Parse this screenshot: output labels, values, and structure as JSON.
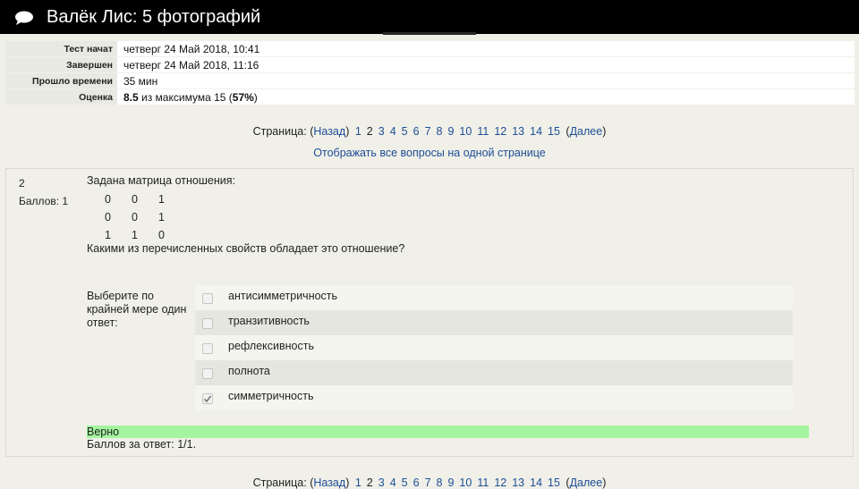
{
  "header": {
    "title": "Валёк Лис: 5 фотографий",
    "icon": "chat-bubble-icon"
  },
  "summary": [
    {
      "label": "Тест начат",
      "value": "четверг 24 Май 2018, 10:41"
    },
    {
      "label": "Завершен",
      "value": "четверг 24 Май 2018, 11:16"
    },
    {
      "label": "Прошло времени",
      "value": "35 мин"
    }
  ],
  "grade": {
    "label": "Оценка",
    "score": "8.5",
    "middle": " из максимума 15 (",
    "percent": "57%",
    "end": ")"
  },
  "pager": {
    "prefix": "Страница: (",
    "prev": "Назад",
    "sep": ")",
    "pages_before": [
      "1"
    ],
    "current": "2",
    "pages_after": [
      "3",
      "4",
      "5",
      "6",
      "7",
      "8",
      "9",
      "10",
      "11",
      "12",
      "13",
      "14",
      "15"
    ],
    "next_open": "(",
    "next": "Далее",
    "next_close": ")"
  },
  "show_all_link": "Отображать все вопросы на одной странице",
  "question": {
    "number": "2",
    "points": "Баллов: 1",
    "text": "Задана матрица отношения:",
    "matrix": [
      [
        "0",
        "0",
        "1"
      ],
      [
        "0",
        "0",
        "1"
      ],
      [
        "1",
        "1",
        "0"
      ]
    ],
    "prompt": "Какими из перечисленных свойств обладает это отношение?",
    "answer_label": "Выберите по крайней мере один ответ:",
    "options": [
      {
        "label": "антисимметричность",
        "checked": false
      },
      {
        "label": "транзитивность",
        "checked": false
      },
      {
        "label": "рефлексивность",
        "checked": false
      },
      {
        "label": "полнота",
        "checked": false
      },
      {
        "label": "симметричность",
        "checked": true
      }
    ],
    "verdict": "Верно",
    "verdict_color": "#a5f5a0",
    "score_line": "Баллов за ответ: 1/1."
  },
  "colors": {
    "link": "#1d4d95",
    "background": "#f0f0e9",
    "topbar": "#000000"
  }
}
